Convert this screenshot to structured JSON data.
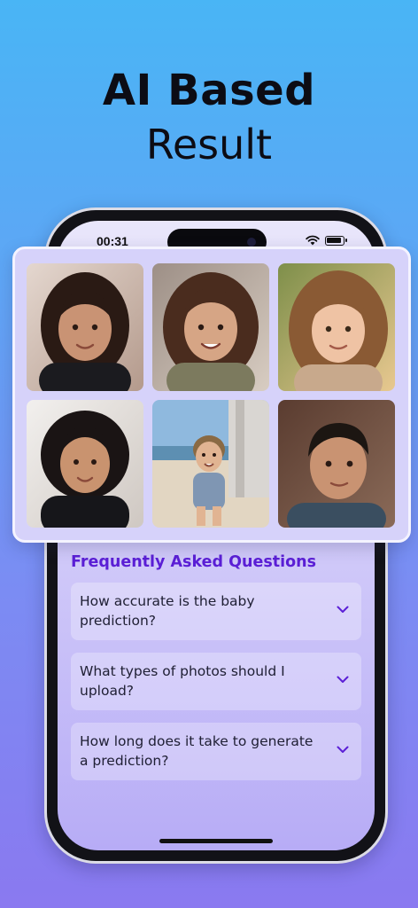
{
  "headline": {
    "line1": "AI Based",
    "line2": "Result"
  },
  "status_bar": {
    "time": "00:31"
  },
  "faq": {
    "title": "Frequently Asked Questions",
    "items": [
      {
        "question": "How accurate is the baby prediction?"
      },
      {
        "question": "What types of photos should I upload?"
      },
      {
        "question": "How long does it take to generate a prediction?"
      }
    ]
  },
  "results": {
    "photos": [
      {
        "subject": "girl-dark-curly-hair"
      },
      {
        "subject": "girl-brown-curly-hair"
      },
      {
        "subject": "girl-light-brown-hair-sunlight"
      },
      {
        "subject": "girl-black-curly-hair"
      },
      {
        "subject": "toddler-on-beach"
      },
      {
        "subject": "boy-dark-hair"
      }
    ]
  },
  "colors": {
    "background_top": "#49b5f5",
    "background_bottom": "#8a79f0",
    "accent": "#5b1fd6",
    "card": "#d6d2fa"
  }
}
